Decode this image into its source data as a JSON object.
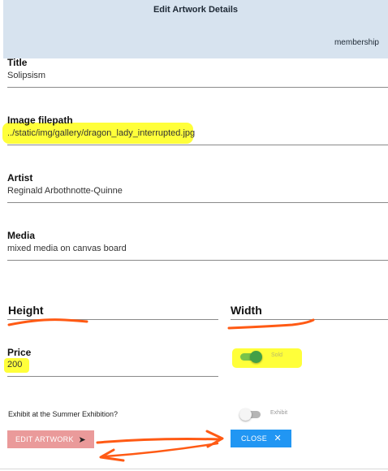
{
  "header": {
    "title": "Edit Artwork Details",
    "membership_link": "membership"
  },
  "form": {
    "title": {
      "label": "Title",
      "value": "Solipsism"
    },
    "image_filepath": {
      "label": "Image filepath",
      "value": "../static/img/gallery/dragon_lady_interrupted.jpg"
    },
    "artist": {
      "label": "Artist",
      "value": "Reginald Arbothnotte-Quinne"
    },
    "media": {
      "label": "Media",
      "value": "mixed media on canvas board"
    },
    "height": {
      "label": "Height",
      "value": ""
    },
    "width": {
      "label": "Width",
      "value": ""
    },
    "price": {
      "label": "Price",
      "value": "200"
    },
    "sold_toggle": {
      "label": "Sold",
      "checked": true
    },
    "exhibit_question": "Exhibit at the Summer Exhibition?",
    "exhibit_toggle": {
      "label": "Exhibit",
      "checked": false
    }
  },
  "buttons": {
    "edit": "EDIT ARTWORK",
    "close": "CLOSE"
  },
  "colors": {
    "highlight": "#ffff3a",
    "annotation": "#ff5a14",
    "toggle_on": "#4caf50",
    "edit_button": "#ea9a9a",
    "close_button": "#2196f3",
    "header": "#d7e3ef"
  },
  "icons": {
    "edit_arrow": "send-arrow-icon",
    "close_x": "close-icon"
  }
}
